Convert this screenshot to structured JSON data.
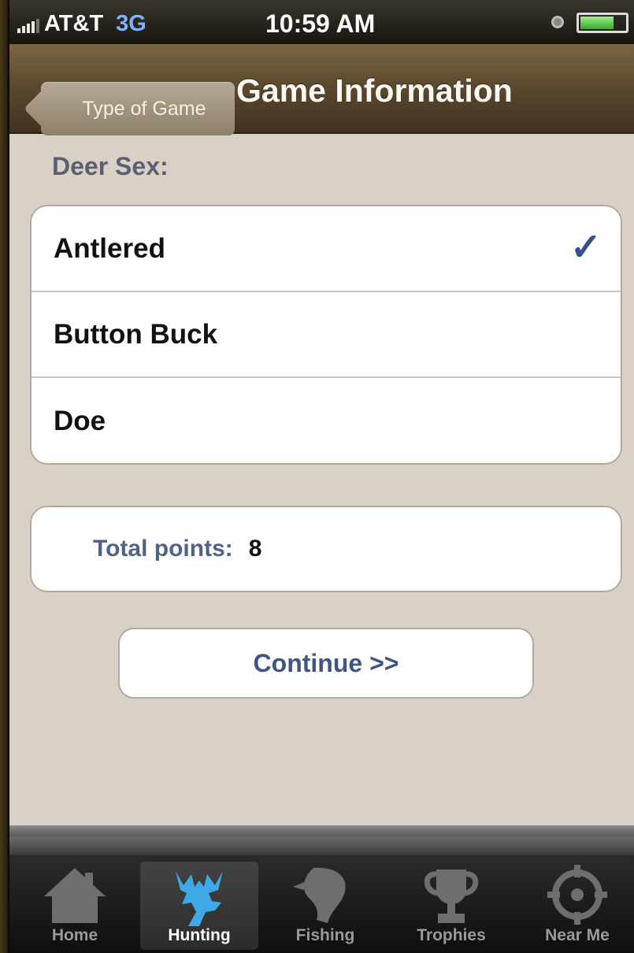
{
  "status_bar": {
    "carrier": "AT&T",
    "network": "3G",
    "time": "10:59 AM"
  },
  "nav": {
    "back_label": "Type of Game",
    "title": "Game Information"
  },
  "section_label": "Deer Sex:",
  "options": [
    {
      "label": "Antlered",
      "selected": true
    },
    {
      "label": "Button Buck",
      "selected": false
    },
    {
      "label": "Doe",
      "selected": false
    }
  ],
  "check_mark": "✓",
  "points": {
    "label": "Total points:",
    "value": "8"
  },
  "continue_label": "Continue >>",
  "tabs": [
    {
      "label": "Home",
      "icon": "home-icon",
      "active": false
    },
    {
      "label": "Hunting",
      "icon": "deer-icon",
      "active": true
    },
    {
      "label": "Fishing",
      "icon": "fish-icon",
      "active": false
    },
    {
      "label": "Trophies",
      "icon": "trophy-icon",
      "active": false
    },
    {
      "label": "Near Me",
      "icon": "crosshair-icon",
      "active": false
    }
  ],
  "colors": {
    "accent": "#3f5582",
    "check": "#3a4f86",
    "hunting_icon": "#3fa9e8"
  }
}
